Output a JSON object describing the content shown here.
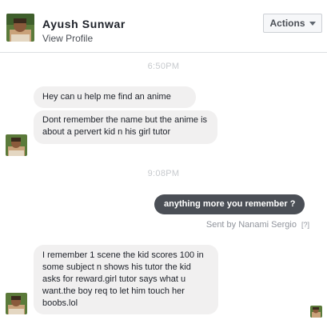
{
  "header": {
    "contact_name": "Ayush Sunwar",
    "view_profile": "View Profile",
    "actions_label": "Actions"
  },
  "conversation": {
    "timestamp_1": "6:50PM",
    "msg_1": "Hey can u help me find an anime",
    "msg_2": "Dont remember the name but the anime is about a pervert kid n his girl tutor",
    "timestamp_2": "9:08PM",
    "msg_3": "anything more you remember ?",
    "sent_by": "Sent by Nanami Sergio",
    "help_link": "[?]",
    "msg_4": "I remember 1 scene the kid scores 100 in some subject n shows his tutor the kid asks for reward.girl tutor says what u want.the boy req to let him touch her boobs.lol"
  },
  "colors": {
    "incoming_bubble": "#f1f0f0",
    "outgoing_bubble": "#4b4f56",
    "timestamp": "#c7cace"
  }
}
